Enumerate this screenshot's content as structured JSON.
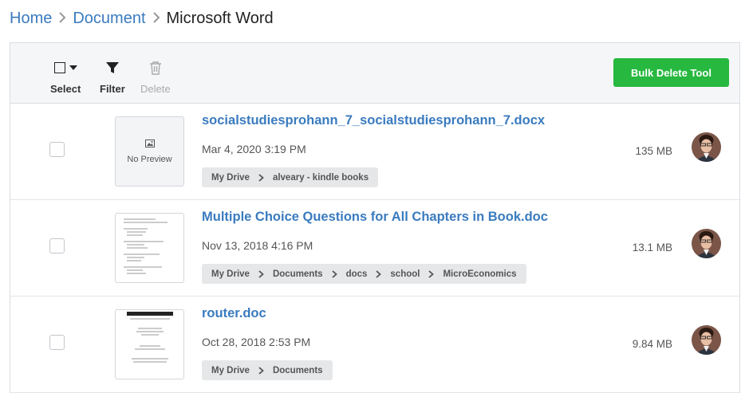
{
  "breadcrumb": {
    "home": "Home",
    "document": "Document",
    "current": "Microsoft Word"
  },
  "toolbar": {
    "select_label": "Select",
    "filter_label": "Filter",
    "delete_label": "Delete",
    "bulk_delete_label": "Bulk Delete Tool",
    "accent_color": "#27b840"
  },
  "files": [
    {
      "name": "socialstudiesprohann_7_socialstudiesprohann_7.docx",
      "date": "Mar 4, 2020 3:19 PM",
      "size": "135 MB",
      "preview": "No Preview",
      "path": [
        "My Drive",
        "alveary - kindle books"
      ]
    },
    {
      "name": "Multiple Choice Questions for All Chapters in Book.doc",
      "date": "Nov 13, 2018 4:16 PM",
      "size": "13.1 MB",
      "path": [
        "My Drive",
        "Documents",
        "docs",
        "school",
        "MicroEconomics"
      ]
    },
    {
      "name": "router.doc",
      "date": "Oct 28, 2018 2:53 PM",
      "size": "9.84 MB",
      "path": [
        "My Drive",
        "Documents"
      ]
    }
  ],
  "link_color": "#3a7bbf"
}
